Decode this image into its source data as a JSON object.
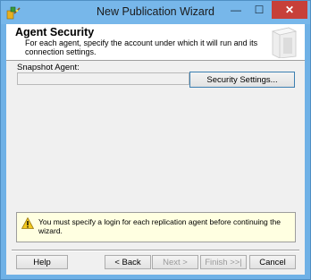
{
  "window": {
    "title": "New Publication Wizard",
    "minimize_glyph": "—",
    "maximize_glyph": "☐",
    "close_glyph": "✕"
  },
  "header": {
    "title": "Agent Security",
    "description": "For each agent, specify the account under which it will run and its connection settings."
  },
  "snapshot": {
    "label": "Snapshot Agent:",
    "value": "",
    "security_button": "Security Settings..."
  },
  "alert": {
    "icon": "warning-icon",
    "message": "You must specify a login for each replication agent before continuing the wizard."
  },
  "footer": {
    "help": "Help",
    "back": "< Back",
    "next": "Next >",
    "finish": "Finish >>|",
    "cancel": "Cancel"
  },
  "colors": {
    "titlebar": "#77b7ea",
    "close_button": "#c74039",
    "alert_background": "#ffffe1",
    "warning_icon": "#f2c81e"
  }
}
